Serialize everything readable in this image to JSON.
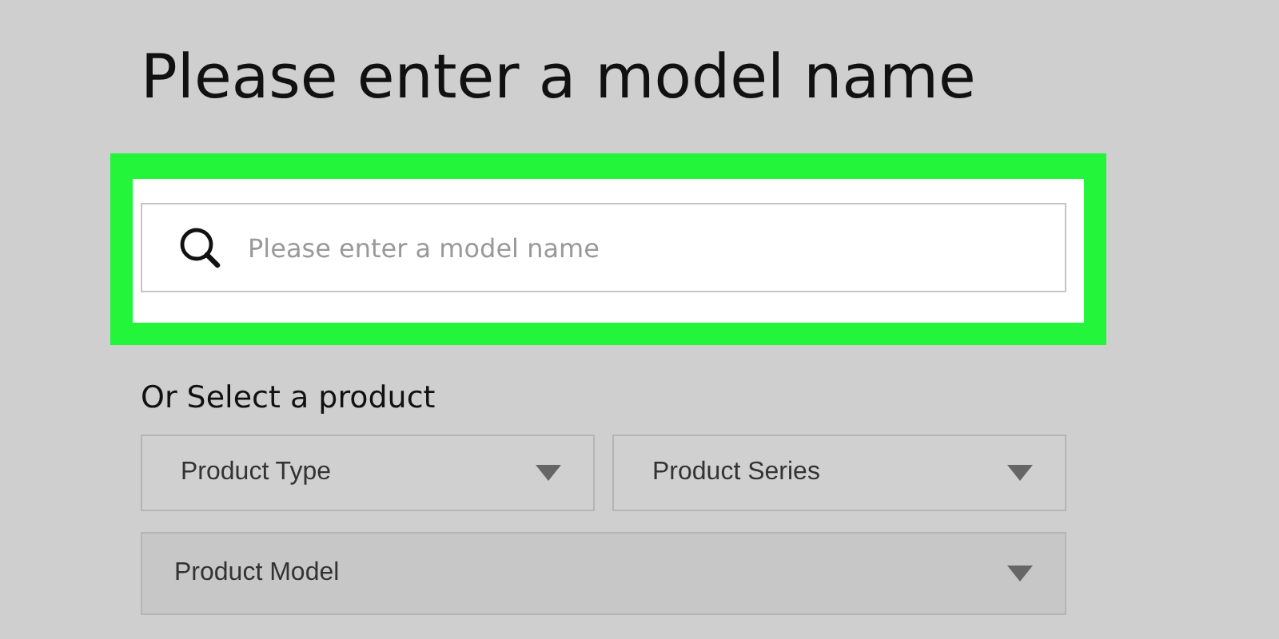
{
  "heading": "Please enter a model name",
  "search": {
    "placeholder": "Please enter a model name",
    "highlighted": true
  },
  "select_label": "Or Select a product",
  "dropdowns": [
    {
      "label": "Product Type"
    },
    {
      "label": "Product Series"
    },
    {
      "label": "Product Model"
    }
  ]
}
